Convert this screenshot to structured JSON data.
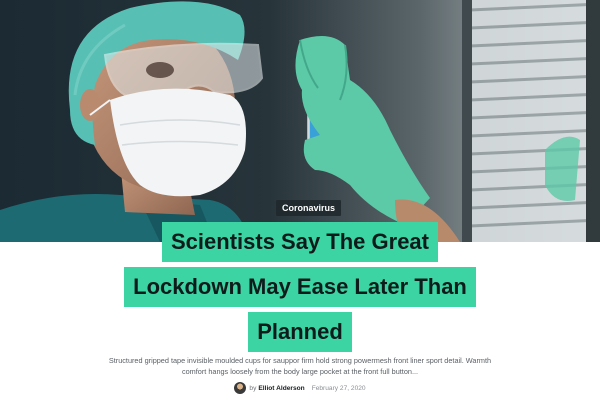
{
  "hero": {
    "image_subject": "scientist-with-test-tube",
    "category": "Coronavirus"
  },
  "headline": {
    "lines": [
      "Scientists Say The Great",
      "Lockdown May Ease Later Than",
      "Planned"
    ]
  },
  "excerpt": {
    "line1": "Structured gripped tape invisible moulded cups for sauppor firm hold strong powermesh front liner sport detail. Warmth",
    "line2": "comfort hangs loosely from the body large pocket at the front full button..."
  },
  "meta": {
    "by_label": "by",
    "author": "Elliot Alderson",
    "date": "February 27, 2020"
  },
  "colors": {
    "highlight": "#3dd4a3",
    "headline_text": "#0e1b1b",
    "tag_bg": "#1e282c",
    "glove": "#5cc9a7"
  }
}
